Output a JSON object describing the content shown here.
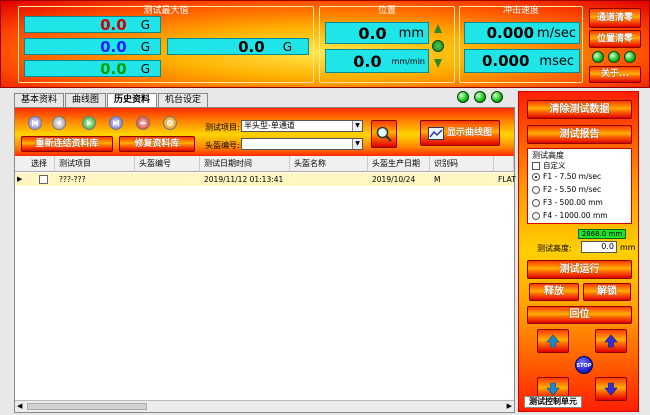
{
  "top": {
    "test_max": {
      "title": "测试最大值",
      "rows": [
        {
          "value": "0.0",
          "unit": "G"
        },
        {
          "value": "0.0",
          "unit": "G"
        },
        {
          "value": "0.0",
          "unit": "G"
        }
      ],
      "extra": {
        "value": "0.0",
        "unit": "G"
      }
    },
    "position": {
      "title": "位置",
      "value": "0.0",
      "unit": "mm",
      "speed_value": "0.0",
      "speed_unit": "mm/min"
    },
    "impact": {
      "title": "冲击速度",
      "value": "0.000",
      "unit": "m/sec",
      "time_value": "0.000",
      "time_unit": "msec"
    },
    "buttons": {
      "clear_channels": "通道清零",
      "clear_position": "位置清零",
      "about": "关于..."
    }
  },
  "tabs": [
    "基本资料",
    "曲线图",
    "历史资料",
    "机台设定"
  ],
  "active_tab": 2,
  "toolbar": {
    "relink_db": "重新连结资料库",
    "repair_db": "修复资料库",
    "test_item_label": "测试项目:",
    "test_item_value": "半头型-单通道",
    "head_no_label": "头盔编号:",
    "head_no_value": "",
    "show_curve": "显示曲线图"
  },
  "table": {
    "columns": [
      "选择",
      "测试项目",
      "头盔编号",
      "测试日期时间",
      "头盔名称",
      "头盔生产日期",
      "识别码",
      ""
    ],
    "rows": [
      {
        "select": "",
        "item": "???-???",
        "helmet_no": "",
        "datetime": "2019/11/12 01:13:41",
        "name": "",
        "prod_date": "2019/10/24",
        "id": "M",
        "extra": "FLAT"
      }
    ]
  },
  "right_panel": {
    "clear_data": "清除测试数据",
    "test_report": "测试报告",
    "height_group_title": "测试高度",
    "height_options": [
      {
        "label": "自定义",
        "selected": false
      },
      {
        "label": "F1 - 7.50 m/sec",
        "selected": true
      },
      {
        "label": "F2 - 5.50 m/sec",
        "selected": false
      },
      {
        "label": "F3 - 500.00 mm",
        "selected": false
      },
      {
        "label": "F4 - 1000.00 mm",
        "selected": false
      }
    ],
    "height_readout": "2868.0 mm",
    "height_input_label": "测试高度:",
    "height_input_value": "0.0",
    "height_unit": "mm",
    "run": "测试运行",
    "release": "释放",
    "unlock": "解锁",
    "return": "回位",
    "stop": "STOP",
    "footer": "测试控制单元"
  },
  "colors": {
    "cyan": "#1fe5e8",
    "value_red": "#d00000",
    "value_blue": "#2020ff",
    "value_green": "#00a000",
    "led_green": "#1cc41c"
  }
}
